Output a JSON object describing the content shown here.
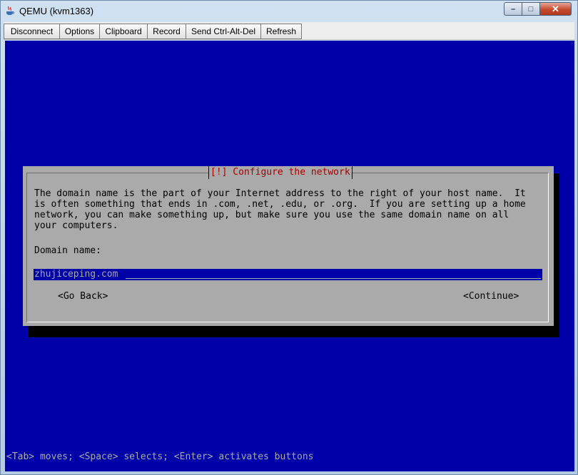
{
  "window": {
    "title": "QEMU (kvm1363)",
    "close_glyph": "✕",
    "min_glyph": "–",
    "max_glyph": "□"
  },
  "toolbar": {
    "buttons": [
      "Disconnect",
      "Options",
      "Clipboard",
      "Record",
      "Send Ctrl-Alt-Del",
      "Refresh"
    ]
  },
  "dialog": {
    "title": "[!] Configure the network",
    "description": "The domain name is the part of your Internet address to the right of your host name.  It\nis often something that ends in .com, .net, .edu, or .org.  If you are setting up a home\nnetwork, you can make something up, but make sure you use the same domain name on all\nyour computers.",
    "field_label": "Domain name:",
    "field_value": "zhujiceping.com",
    "go_back_label": "<Go Back>",
    "continue_label": "<Continue>"
  },
  "help_text": "<Tab> moves; <Space> selects; <Enter> activates buttons",
  "colors": {
    "screen_bg": "#0000a8",
    "dialog_bg": "#aaaaaa",
    "title_red": "#a80000"
  }
}
